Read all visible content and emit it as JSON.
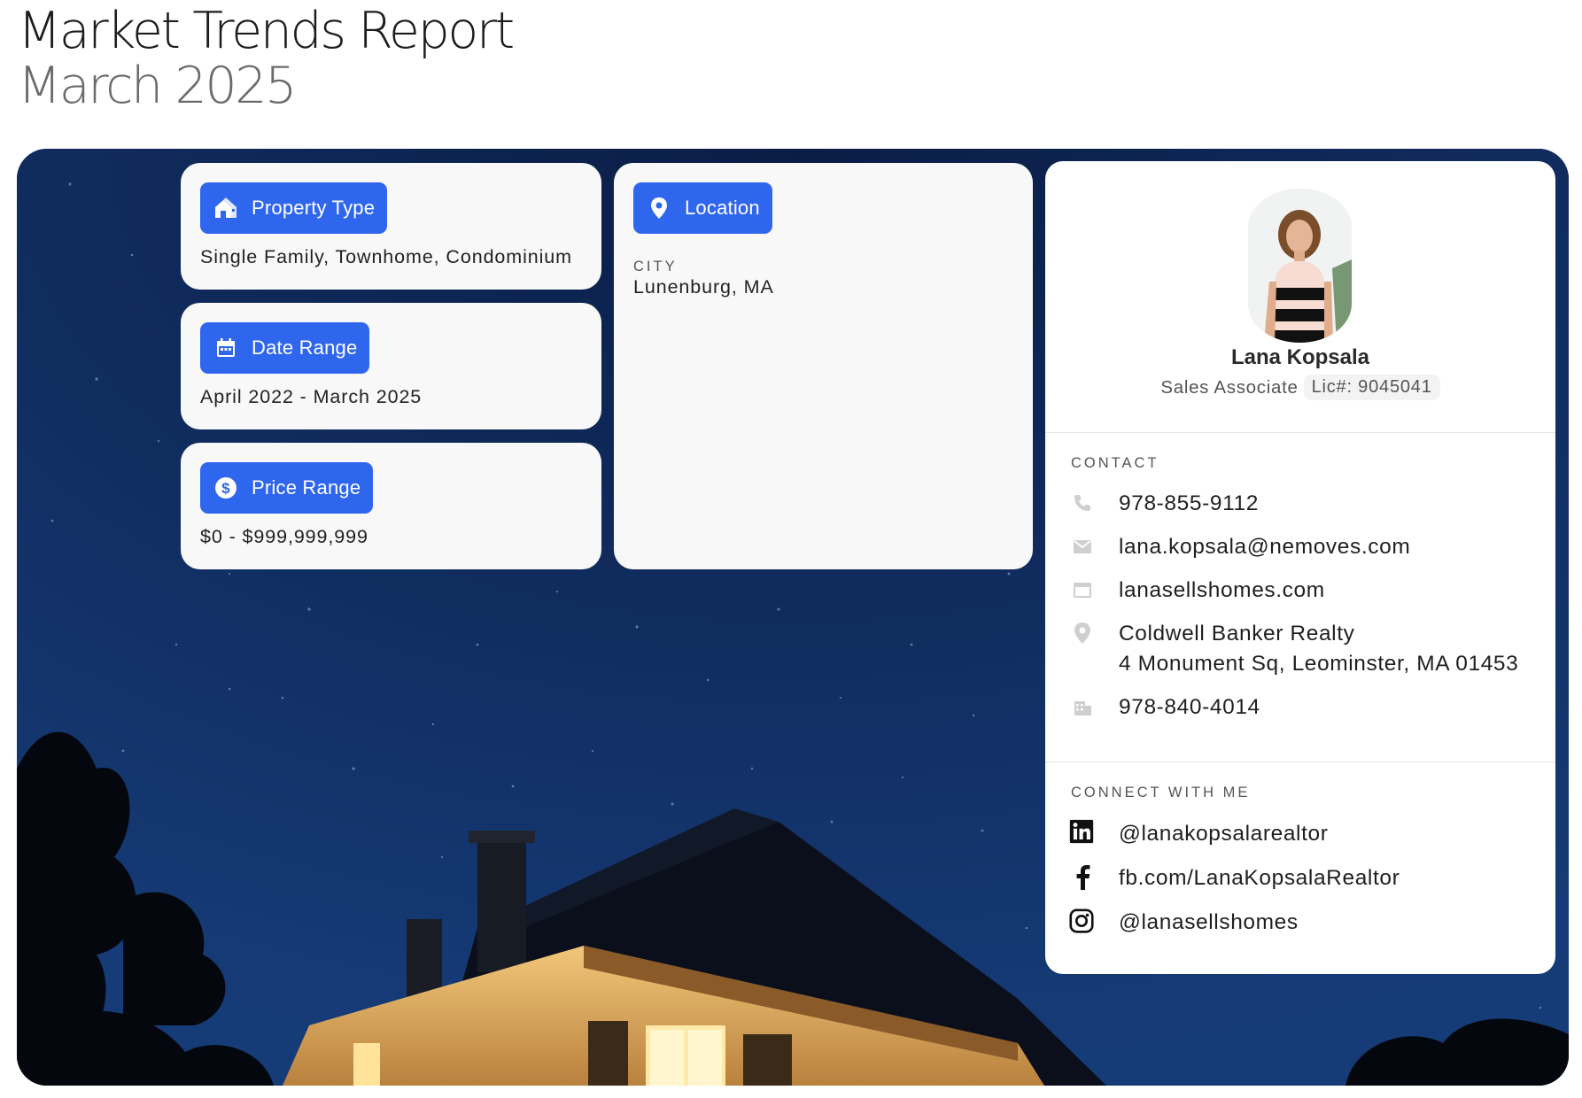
{
  "header": {
    "title": "Market Trends Report",
    "subtitle": "March 2025"
  },
  "filters": {
    "property_type": {
      "label": "Property Type",
      "value": "Single Family, Townhome, Condominium",
      "icon": "house-icon"
    },
    "date_range": {
      "label": "Date Range",
      "value": "April 2022 - March 2025",
      "icon": "calendar-icon"
    },
    "price_range": {
      "label": "Price Range",
      "value": "$0 - $999,999,999",
      "icon": "dollar-icon"
    },
    "location": {
      "label": "Location",
      "caption": "CITY",
      "value": "Lunenburg, MA",
      "icon": "map-pin-icon"
    }
  },
  "agent": {
    "name": "Lana Kopsala",
    "role": "Sales Associate",
    "license": "Lic#: 9045041",
    "contact_caption": "CONTACT",
    "contact": {
      "phone": "978-855-9112",
      "email": "lana.kopsala@nemoves.com",
      "website": "lanasellshomes.com",
      "office_name": "Coldwell Banker Realty",
      "office_address": "4 Monument Sq, Leominster, MA 01453",
      "office_phone": "978-840-4014"
    },
    "social_caption": "CONNECT WITH ME",
    "social": {
      "linkedin": "@lanakopsalarealtor",
      "facebook": "fb.com/LanaKopsalaRealtor",
      "instagram": "@lanasellshomes"
    }
  },
  "colors": {
    "accent": "#2f66ee",
    "card_bg": "#f8f8f8",
    "night_sky": "#0c2652"
  }
}
